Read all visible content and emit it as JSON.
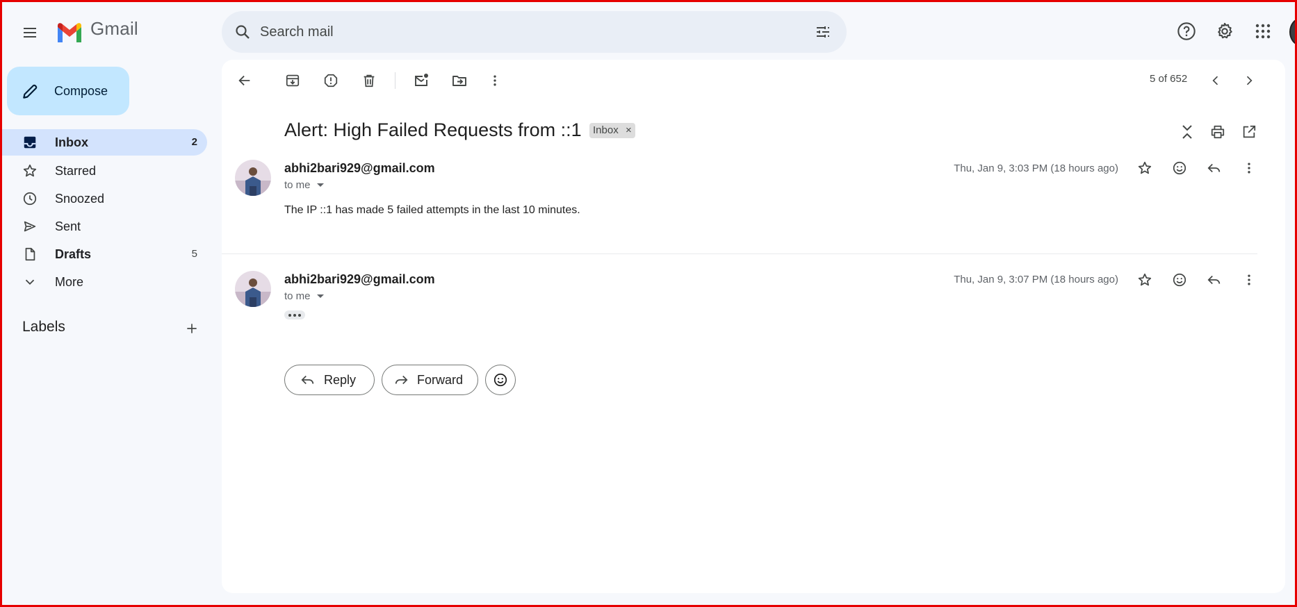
{
  "app": {
    "brand": "Gmail"
  },
  "search": {
    "placeholder": "Search mail"
  },
  "sidebar": {
    "compose_label": "Compose",
    "items": [
      {
        "label": "Inbox",
        "count": "2",
        "icon": "inbox-icon",
        "active": true
      },
      {
        "label": "Starred",
        "count": "",
        "icon": "star-icon"
      },
      {
        "label": "Snoozed",
        "count": "",
        "icon": "clock-icon"
      },
      {
        "label": "Sent",
        "count": "",
        "icon": "send-icon"
      },
      {
        "label": "Drafts",
        "count": "5",
        "icon": "draft-icon"
      },
      {
        "label": "More",
        "count": "",
        "icon": "chevron-down-icon"
      }
    ],
    "labels_title": "Labels"
  },
  "toolbar": {
    "counter": "5 of 652"
  },
  "thread": {
    "subject": "Alert: High Failed Requests from ::1",
    "chip": "Inbox",
    "chip_close": "×",
    "messages": [
      {
        "sender": "abhi2bari929@gmail.com",
        "to": "to me",
        "date": "Thu, Jan 9, 3:03 PM (18 hours ago)",
        "body": "The IP ::1 has made 5 failed attempts in the last 10 minutes."
      },
      {
        "sender": "abhi2bari929@gmail.com",
        "to": "to me",
        "date": "Thu, Jan 9, 3:07 PM (18 hours ago)",
        "body": ""
      }
    ],
    "reply_label": "Reply",
    "forward_label": "Forward"
  },
  "colors": {
    "background": "#f6f8fc",
    "compose": "#c2e7ff",
    "active_nav": "#d3e3fd",
    "search_bg": "#e9eef6",
    "frame": "#e60000"
  }
}
